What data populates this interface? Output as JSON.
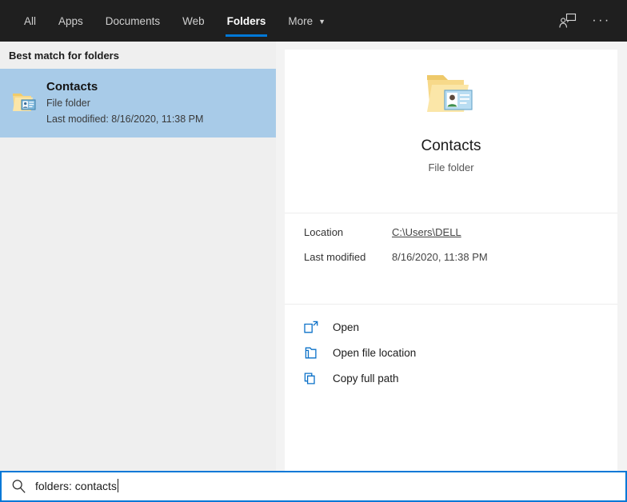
{
  "topbar": {
    "tabs": [
      {
        "label": "All",
        "active": false
      },
      {
        "label": "Apps",
        "active": false
      },
      {
        "label": "Documents",
        "active": false
      },
      {
        "label": "Web",
        "active": false
      },
      {
        "label": "Folders",
        "active": true
      },
      {
        "label": "More",
        "active": false,
        "chevron": "▼"
      }
    ],
    "feedback_icon": "person-feedback-icon",
    "overflow_label": "···",
    "background": "#1f1f1f",
    "accent": "#0078d7"
  },
  "left_pane": {
    "section_header": "Best match for folders",
    "result": {
      "title": "Contacts",
      "subtitle": "File folder",
      "modified": "Last modified: 8/16/2020, 11:38 PM",
      "icon": "folder-contacts-icon",
      "selected_color": "#a8cbe8"
    }
  },
  "detail_card": {
    "icon": "folder-contacts-large-icon",
    "title": "Contacts",
    "subtitle": "File folder",
    "meta": [
      {
        "key": "Location",
        "value": "C:\\Users\\DELL",
        "is_link": true
      },
      {
        "key": "Last modified",
        "value": "8/16/2020, 11:38 PM",
        "is_link": false
      }
    ],
    "actions": [
      {
        "label": "Open",
        "icon": "open-external-icon"
      },
      {
        "label": "Open file location",
        "icon": "folder-open-icon"
      },
      {
        "label": "Copy full path",
        "icon": "copy-icon"
      }
    ]
  },
  "searchbar": {
    "icon": "search-icon",
    "value": "folders: contacts",
    "placeholder": "Type here to search",
    "border_color": "#0078d7"
  }
}
